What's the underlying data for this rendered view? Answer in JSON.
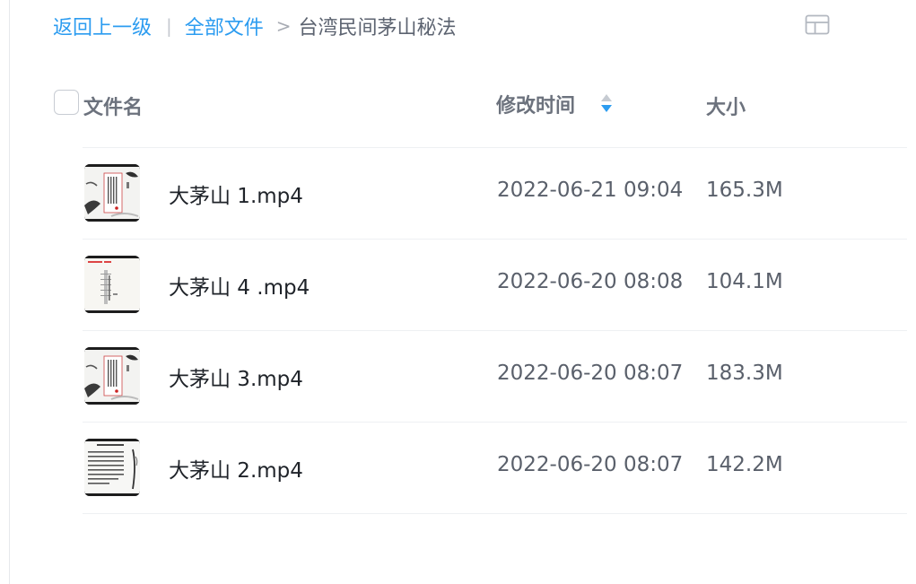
{
  "breadcrumb": {
    "back_label": "返回上一级",
    "separator": "|",
    "all_files_label": "全部文件",
    "arrow": ">",
    "current_folder": "台湾民间茅山秘法"
  },
  "view_toggle_icon": "grid-view-icon",
  "header": {
    "name_label": "文件名",
    "time_label": "修改时间",
    "size_label": "大小",
    "sort_icon": "sort-icon"
  },
  "accent_color": "#2c9cf0",
  "files": [
    {
      "name": "大茅山 1.mp4",
      "modified": "2022-06-21 09:04",
      "size": "165.3M",
      "thumb_icon": "video-thumbnail-icon"
    },
    {
      "name": "大茅山 4 .mp4",
      "modified": "2022-06-20 08:08",
      "size": "104.1M",
      "thumb_icon": "video-thumbnail-icon"
    },
    {
      "name": "大茅山 3.mp4",
      "modified": "2022-06-20 08:07",
      "size": "183.3M",
      "thumb_icon": "video-thumbnail-icon"
    },
    {
      "name": "大茅山 2.mp4",
      "modified": "2022-06-20 08:07",
      "size": "142.2M",
      "thumb_icon": "video-thumbnail-icon"
    }
  ]
}
